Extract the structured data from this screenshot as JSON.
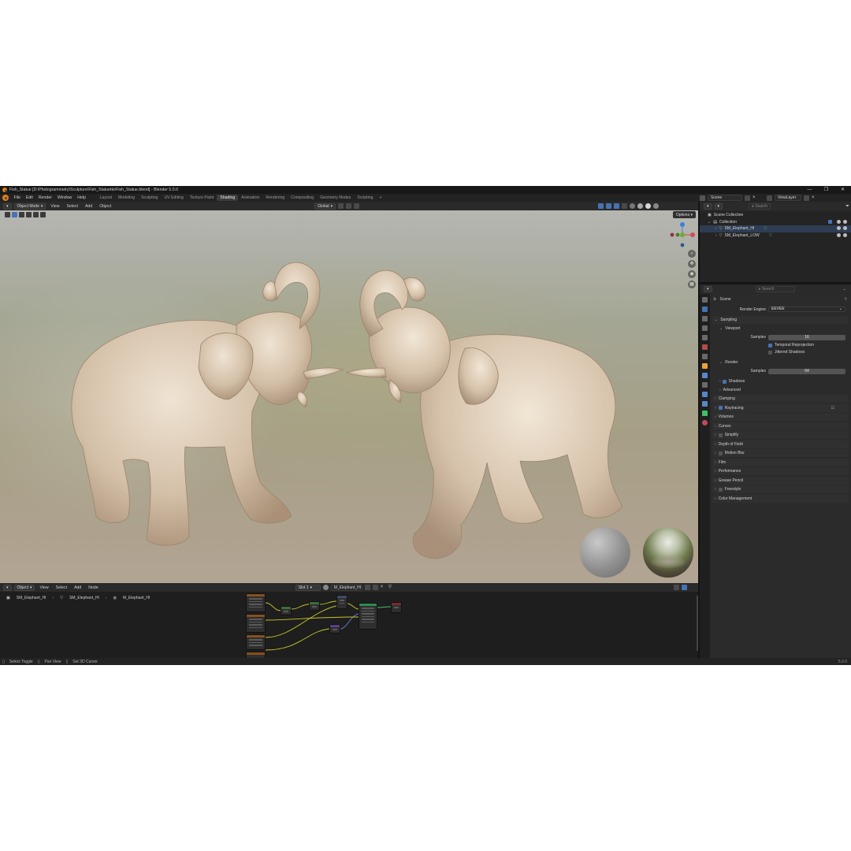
{
  "window": {
    "title": "Fish_Statue [D:\\Photogrammetry\\Sculpture\\Fish_Statuette\\Fish_Statue.blend] - Blender 5.0.0",
    "controls": [
      "—",
      "❐",
      "✕"
    ]
  },
  "menu": [
    "File",
    "Edit",
    "Render",
    "Window",
    "Help"
  ],
  "workspaces": [
    "Layout",
    "Modeling",
    "Sculpting",
    "UV Editing",
    "Texture Paint",
    "Shading",
    "Animation",
    "Rendering",
    "Compositing",
    "Geometry Nodes",
    "Scripting"
  ],
  "active_workspace": "Shading",
  "add_workspace": "+",
  "scene_field": "Scene",
  "viewlayer_field": "ViewLayer",
  "viewport": {
    "mode": "Object Mode",
    "menus": [
      "View",
      "Select",
      "Add",
      "Object"
    ],
    "transform_orientation": "Global",
    "options": "Options",
    "gizmo_axes": [
      "X",
      "Y",
      "Z"
    ]
  },
  "node_editor": {
    "type": "Object",
    "menus": [
      "View",
      "Select",
      "Add",
      "Node"
    ],
    "slot": "Slot 1",
    "material": "M_Elephant_HI",
    "breadcrumb": [
      "SM_Elephant_HI",
      "SM_Elephant_HI",
      "M_Elephant_HI"
    ]
  },
  "outliner": {
    "search_placeholder": "Search",
    "root": "Scene Collection",
    "collection": "Collection",
    "items": [
      "SM_Elephant_HI",
      "SM_Elephant_LOW"
    ]
  },
  "properties": {
    "search_placeholder": "Search",
    "context": "Scene",
    "render_engine_label": "Render Engine",
    "render_engine": "EEVEE",
    "sampling": "Sampling",
    "viewport": "Viewport",
    "samples_label": "Samples",
    "viewport_samples": "16",
    "temporal_reprojection": "Temporal Reprojection",
    "jittered_shadows": "Jittered Shadows",
    "render": "Render",
    "render_samples": "64",
    "shadows": "Shadows",
    "advanced": "Advanced",
    "panels": [
      "Clamping",
      "Raytracing",
      "Volumes",
      "Curves",
      "Simplify",
      "Depth of Field",
      "Motion Blur",
      "Film",
      "Performance",
      "Grease Pencil",
      "Freestyle",
      "Color Management"
    ]
  },
  "statusbar": {
    "items": [
      "Select Toggle",
      "Pan View",
      "Set 3D Cursor"
    ],
    "version": "5.0.0"
  },
  "colors": {
    "accent": "#4772b3",
    "blender_orange": "#e87d0d",
    "mesh_green": "#3fbf6a",
    "ceramic": "#d8c6b0"
  }
}
